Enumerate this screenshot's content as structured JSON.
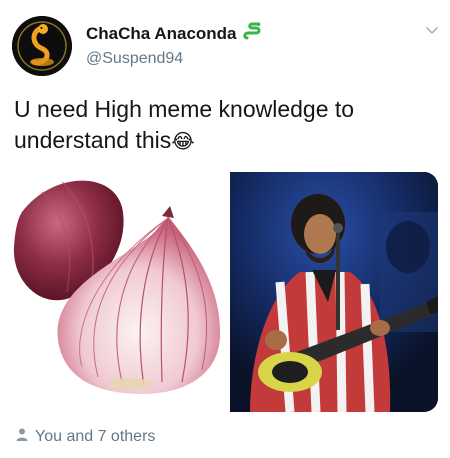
{
  "tweet": {
    "display_name": "ChaCha Anaconda",
    "handle": "@Suspend94",
    "text": "U need High meme knowledge to understand this",
    "emoji": "😂",
    "likes_text": "You and 7 others"
  },
  "icons": {
    "name_badge": "snake-emoji-icon",
    "menu": "chevron-down-icon",
    "likes": "person-icon"
  },
  "colors": {
    "text_primary": "#14171a",
    "text_secondary": "#657786",
    "badge": "#3bb34a"
  }
}
